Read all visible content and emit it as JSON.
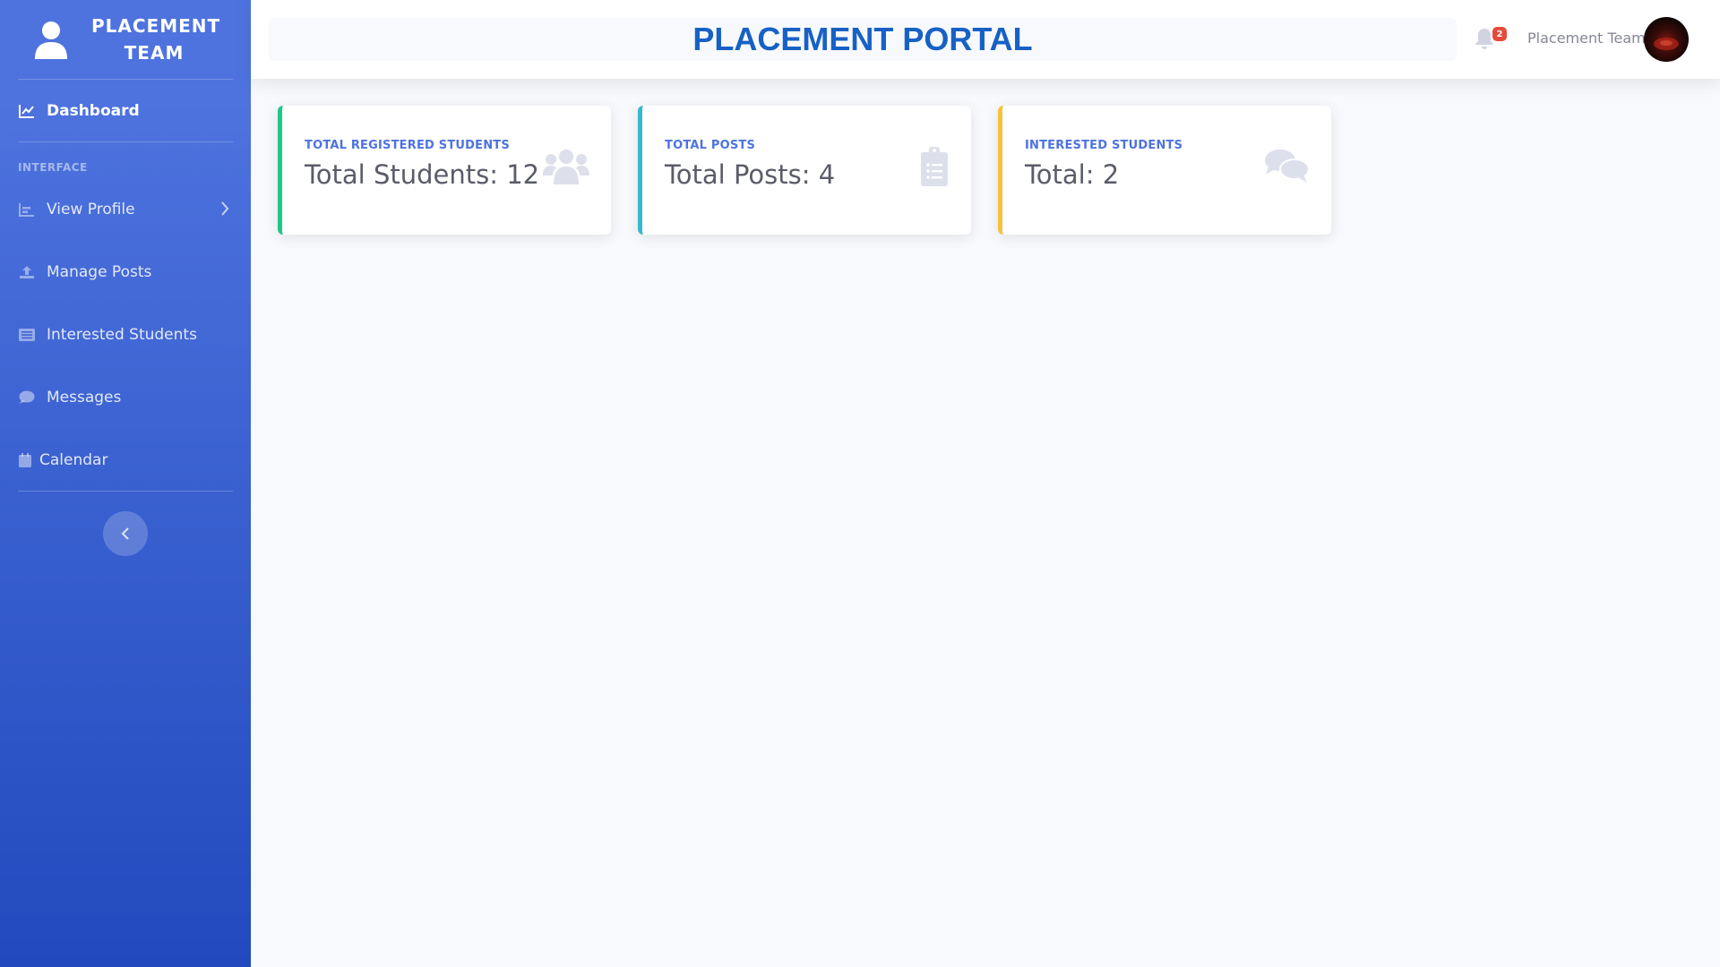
{
  "sidebar": {
    "brand": "PLACEMENT TEAM",
    "heading": "INTERFACE",
    "items": [
      {
        "label": "Dashboard",
        "icon": "chart-line-icon"
      },
      {
        "label": "View Profile",
        "icon": "bar-chart-icon"
      },
      {
        "label": "Manage Posts",
        "icon": "upload-icon"
      },
      {
        "label": "Interested Students",
        "icon": "list-icon"
      },
      {
        "label": "Messages",
        "icon": "comment-icon"
      },
      {
        "label": "Calendar",
        "icon": "calendar-icon"
      }
    ]
  },
  "topbar": {
    "title": "PLACEMENT PORTAL",
    "notification_count": "2",
    "user_name": "Placement Team"
  },
  "cards": [
    {
      "label": "TOTAL REGISTERED STUDENTS",
      "value": "Total Students: 12",
      "icon": "users-icon",
      "accent": "#1cc88a"
    },
    {
      "label": "TOTAL POSTS",
      "value": "Total Posts: 4",
      "icon": "clipboard-list-icon",
      "accent": "#36b9cc"
    },
    {
      "label": "INTERESTED STUDENTS",
      "value": "Total: 2",
      "icon": "comments-icon",
      "accent": "#f6c23e"
    }
  ],
  "colors": {
    "sidebar_start": "#4e73df",
    "sidebar_end": "#224abe",
    "title": "#1761c6",
    "badge": "#e74a3b"
  }
}
